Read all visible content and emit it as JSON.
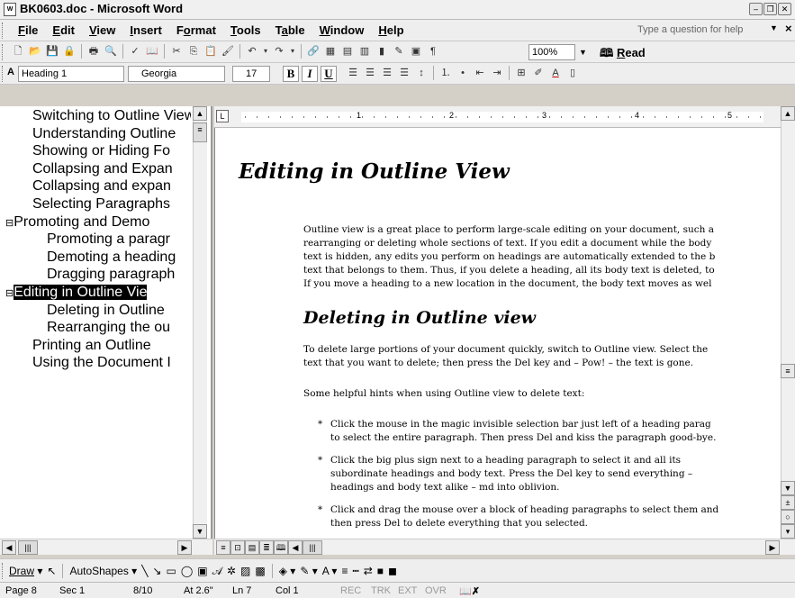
{
  "window": {
    "title": "BK0603.doc - Microsoft Word",
    "app_icon": "word-doc-icon",
    "buttons": [
      "minimize-icon",
      "restore-icon",
      "close-icon"
    ]
  },
  "menu": {
    "items": [
      {
        "label": "File",
        "u": "F",
        "rest": "ile"
      },
      {
        "label": "Edit",
        "u": "E",
        "rest": "dit"
      },
      {
        "label": "View",
        "u": "V",
        "rest": "iew"
      },
      {
        "label": "Insert",
        "u": "I",
        "rest": "nsert"
      },
      {
        "label": "Format",
        "pre": "F",
        "u": "o",
        "rest": "rmat"
      },
      {
        "label": "Tools",
        "u": "T",
        "rest": "ools"
      },
      {
        "label": "Table",
        "pre": "T",
        "u": "a",
        "rest": "ble"
      },
      {
        "label": "Window",
        "u": "W",
        "rest": "indow"
      },
      {
        "label": "Help",
        "u": "H",
        "rest": "elp"
      }
    ],
    "help_placeholder": "Type a question for help"
  },
  "standard_toolbar": {
    "zoom": "100%",
    "read_label": "Read",
    "read_u": "R",
    "read_rest": "ead"
  },
  "formatting_toolbar": {
    "style": "Heading 1",
    "font": "Georgia",
    "size": "17",
    "bold": "B",
    "italic": "I",
    "underline": "U"
  },
  "document_map": {
    "items": [
      {
        "label": "Switching to Outline View",
        "level": 1,
        "selected": false
      },
      {
        "label": "Understanding Outline",
        "level": 1,
        "selected": false
      },
      {
        "label": "Showing or Hiding Fo",
        "level": 1,
        "selected": false
      },
      {
        "label": "Collapsing and Expan",
        "level": 1,
        "selected": false
      },
      {
        "label": "Collapsing and expan",
        "level": 1,
        "selected": false
      },
      {
        "label": "Selecting Paragraphs",
        "level": 1,
        "selected": false
      },
      {
        "label": "Promoting and Demo",
        "level": 0,
        "toggle": "⊟",
        "selected": false
      },
      {
        "label": "Promoting a paragr",
        "level": 2,
        "selected": false
      },
      {
        "label": "Demoting a heading",
        "level": 2,
        "selected": false
      },
      {
        "label": "Dragging paragraph",
        "level": 2,
        "selected": false
      },
      {
        "label": "Editing in Outline Vie",
        "level": 0,
        "toggle": "⊟",
        "selected": true
      },
      {
        "label": "Deleting in Outline",
        "level": 2,
        "selected": false
      },
      {
        "label": "Rearranging the ou",
        "level": 2,
        "selected": false
      },
      {
        "label": "Printing an Outline",
        "level": 1,
        "selected": false
      },
      {
        "label": "Using the Document I",
        "level": 1,
        "selected": false
      }
    ]
  },
  "ruler": {
    "numbers": [
      "1",
      "2",
      "3",
      "4",
      "5"
    ]
  },
  "document": {
    "heading1": "Editing in Outline View",
    "para1": [
      "Outline view is a great place to perform large-scale editing on your document, such a",
      "rearranging or deleting whole sections of text. If you edit a document while the body",
      "text is hidden, any edits you perform on headings are automatically extended to the b",
      "text that belongs to them. Thus, if you delete a heading, all its body text is deleted, to",
      "If you move a heading to a new location in the document, the body text moves as wel"
    ],
    "heading2": "Deleting in Outline view",
    "para2": [
      "To delete large portions of your document quickly, switch to Outline view. Select the",
      "text that you want to delete; then press the Del key and – Pow! – the text is gone."
    ],
    "para3": "Some helpful hints when using Outline view to delete text:",
    "bullets": [
      [
        "Click the mouse in the magic invisible selection bar just left of a heading parag",
        "to select the entire paragraph. Then press Del and kiss the paragraph good-bye."
      ],
      [
        "Click the big plus sign next to a heading paragraph to select it and all its",
        "subordinate headings and body text. Press the Del key to send everything –",
        "headings and body text alike – md into oblivion."
      ],
      [
        "Click and drag the mouse over a block of heading paragraphs to select them and",
        "then press Del to delete everything that you selected."
      ]
    ],
    "bullet_char": "*"
  },
  "drawing_toolbar": {
    "draw": "Draw",
    "autoshapes": "AutoShapes"
  },
  "status": {
    "page": "Page 8",
    "sec": "Sec 1",
    "of": "8/10",
    "at": "At 2.6\"",
    "ln": "Ln 7",
    "col": "Col 1",
    "rec": "REC",
    "trk": "TRK",
    "ext": "EXT",
    "ovr": "OVR"
  }
}
